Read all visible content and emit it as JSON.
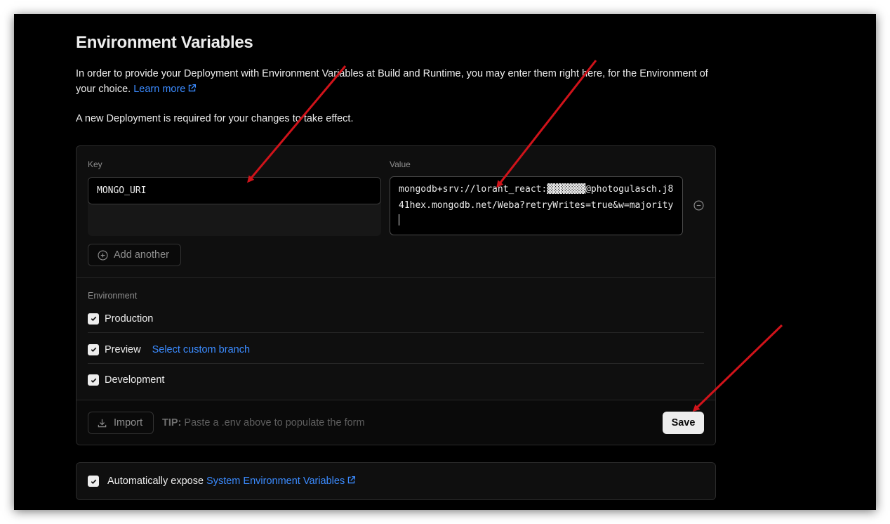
{
  "page": {
    "title": "Environment Variables",
    "description_prefix": "In order to provide your Deployment with Environment Variables at Build and Runtime, you may enter them right here, for the Environment of your choice.",
    "learn_more": "Learn more",
    "note": "A new Deployment is required for your changes to take effect."
  },
  "form": {
    "key_label": "Key",
    "value_label": "Value",
    "key_value": "MONGO_URI",
    "value_value": "mongodb+srv://lorant_react:▓▓▓▓▓▓▓@photogulasch.j841hex.mongodb.net/Weba?retryWrites=true&w=majority",
    "add_another": "Add another"
  },
  "environment": {
    "label": "Environment",
    "options": [
      {
        "label": "Production",
        "checked": true
      },
      {
        "label": "Preview",
        "checked": true,
        "link": "Select custom branch"
      },
      {
        "label": "Development",
        "checked": true
      }
    ]
  },
  "footer": {
    "import": "Import",
    "tip_label": "TIP:",
    "tip_text": "Paste a .env above to populate the form",
    "save": "Save"
  },
  "expose": {
    "checked": true,
    "text": "Automatically expose",
    "link": "System Environment Variables"
  },
  "colors": {
    "accent_link": "#3b8bff",
    "annotation_arrow": "#d0131a",
    "background": "#000000"
  },
  "icons": [
    "external-link-icon",
    "minus-circle-icon",
    "plus-circle-icon",
    "check-icon",
    "download-icon"
  ]
}
